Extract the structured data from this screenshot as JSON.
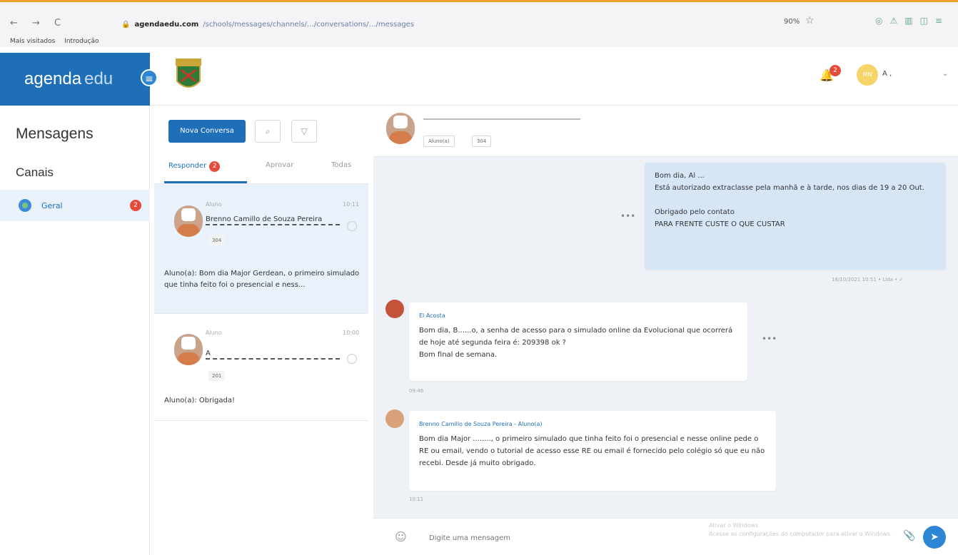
{
  "browser": {
    "nav": "← → C",
    "url_host": "agendaedu.com",
    "url_rest": "/schools/messages/channels/…/conversations/…/messages",
    "zoom": "90%",
    "bookmarks": [
      "Mais visitados",
      "Introdução"
    ]
  },
  "app": {
    "logo_main": "agenda",
    "logo_sub": "edu",
    "notifications_count": "2",
    "user_initials": "MN",
    "user_name": "A ,"
  },
  "sidebar": {
    "title": "Mensagens",
    "section": "Canais",
    "channel_label": "Geral",
    "channel_badge": "2"
  },
  "conversations": {
    "new_button": "Nova Conversa",
    "tabs": [
      {
        "label": "Responder",
        "badge": "2"
      },
      {
        "label": "Aprovar"
      },
      {
        "label": "Todas"
      }
    ],
    "items": [
      {
        "role": "Aluno",
        "time": "10:11",
        "name": "Brenno Camillo de Souza Pereira",
        "class_tag": "304",
        "preview": "Aluno(a): Bom dia Major Gerdean, o primeiro simulado que tinha feito foi o presencial e ness..."
      },
      {
        "role": "Aluno",
        "time": "10:00",
        "name": "A",
        "class_tag": "201",
        "preview": "Aluno(a): Obrigada!"
      }
    ]
  },
  "chat": {
    "header_tags": [
      "Aluno(a)",
      "304"
    ],
    "messages": [
      {
        "direction": "out",
        "text_lines": [
          "Bom dia, Al ...",
          "Está autorizado extraclasse pela manhã e à tarde, nos dias de 19 a 20 Out.",
          "",
          "Obrigado pelo contato",
          "PARA FRENTE CUSTE O QUE CUSTAR"
        ],
        "time": "16/10/2021 10:51 • Lida • ✓"
      },
      {
        "direction": "in",
        "author": "El Acosta",
        "text_lines": [
          "Bom dia, B......o, a senha de acesso para o simulado online da Evolucional que ocorrerá de hoje até segunda feira é: 209398 ok ?",
          "Bom final de semana."
        ],
        "time": "09:46"
      },
      {
        "direction": "in",
        "author": "Brenno Camillo de Souza Pereira - Aluno(a)",
        "text_lines": [
          "Bom dia Major ........, o primeiro simulado que tinha feito foi o presencial e nesse online pede o RE ou email, vendo o tutorial de acesso esse RE ou email é fornecido pelo colégio só que eu não recebi. Desde já muito obrigado."
        ],
        "time": "10:11"
      }
    ],
    "composer_placeholder": "Digite uma mensagem",
    "watermark_line1": "Ativar o Windows",
    "watermark_line2": "Acesse as configurações do computador para ativar o Windows."
  },
  "colors": {
    "brand": "#1e6fb8",
    "badge": "#e64a3b",
    "selected_bg": "#e9f1fb",
    "outgoing_bubble": "#d6e6f5",
    "chat_bg": "#eef1f5"
  },
  "icons": [
    "back-icon",
    "forward-icon",
    "reload-icon",
    "menu-toggle-icon",
    "school-crest-icon",
    "bell-icon",
    "search-icon",
    "filter-icon",
    "emoji-icon",
    "attach-icon",
    "send-icon"
  ]
}
